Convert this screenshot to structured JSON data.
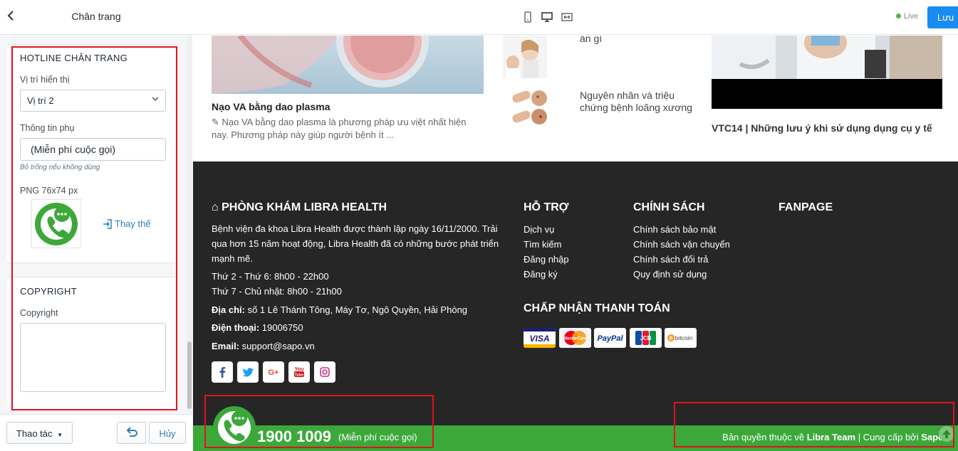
{
  "sidebar": {
    "title": "Chân trang",
    "hotline_section": {
      "heading": "HOTLINE CHÂN TRANG",
      "position_label": "Vị trí hiển thị",
      "position_value": "Vị trí 2",
      "extra_label": "Thông tin phụ",
      "extra_value": "(Miễn phí cuộc gọi)",
      "extra_hint": "Bỏ trống nếu không dùng",
      "image_label": "PNG 76x74 px",
      "replace_label": "Thay thế"
    },
    "copyright_section": {
      "heading": "COPYRIGHT",
      "field_label": "Copyright",
      "field_value": ""
    },
    "footer": {
      "actions_label": "Thao tác",
      "cancel_label": "Hủy"
    }
  },
  "topbar": {
    "live_label": "Live",
    "save_label": "Lưu",
    "devices": [
      "mobile-icon",
      "desktop-icon",
      "fullwidth-icon"
    ]
  },
  "preview": {
    "news": {
      "main_title": "Nạo VA bằng dao plasma",
      "main_desc": "Nạo VA bằng dao plasma là phương pháp ưu việt nhất hiện nay. Phương pháp này giúp người bệnh ít ...",
      "mini1_title": "ăn gì",
      "mini2_title": "Nguyên nhân và triệu chứng bệnh loãng xương",
      "video_title": "VTC14 | Những lưu ý khi sử dụng dụng cụ y tế"
    },
    "footer": {
      "clinic_heading": "PHÒNG KHÁM LIBRA HEALTH",
      "intro": "Bệnh viện đa khoa Libra Health được thành lập ngày 16/11/2000. Trải qua hơn 15 năm hoạt động, Libra Health đã có những bước phát triển mạnh mẽ.",
      "hours1": "Thứ 2 - Thứ 6: 8h00 - 22h00",
      "hours2": "Thứ 7 - Chủ nhật: 8h00 - 21h00",
      "address_label": "Địa chỉ:",
      "address": "số 1 Lê Thánh Tông, Máy Tơ, Ngô Quyền, Hải Phòng",
      "phone_label": "Điện thoại:",
      "phone": "19006750",
      "email_label": "Email:",
      "email": "support@sapo.vn",
      "support_heading": "HỖ TRỢ",
      "support_links": [
        "Dịch vụ",
        "Tìm kiếm",
        "Đăng nhập",
        "Đăng ký"
      ],
      "policy_heading": "CHÍNH SÁCH",
      "policy_links": [
        "Chính sách bảo mật",
        "Chính sách vận chuyển",
        "Chính sách đổi trả",
        "Quy định sử dụng"
      ],
      "fanpage_heading": "FANPAGE",
      "payment_heading": "CHẤP NHẬN THANH TOÁN",
      "payments": [
        "VISA",
        "MasterCard",
        "PayPal",
        "JCB",
        "bitcoin"
      ],
      "social": [
        "f",
        "t",
        "G+",
        "You",
        "ig"
      ],
      "hotline_number": "1900 1009",
      "hotline_note": "(Miễn phí cuộc gọi)",
      "copyright_prefix": "Bản quyền thuộc về ",
      "copyright_team": "Libra Team",
      "copyright_mid": " | Cung cấp bởi ",
      "copyright_brand": "Sapo"
    }
  },
  "colors": {
    "accent": "#1a8bf0",
    "footer_bg": "#262626",
    "hotline_green": "#3ca83a",
    "highlight_red": "#e0121f"
  }
}
